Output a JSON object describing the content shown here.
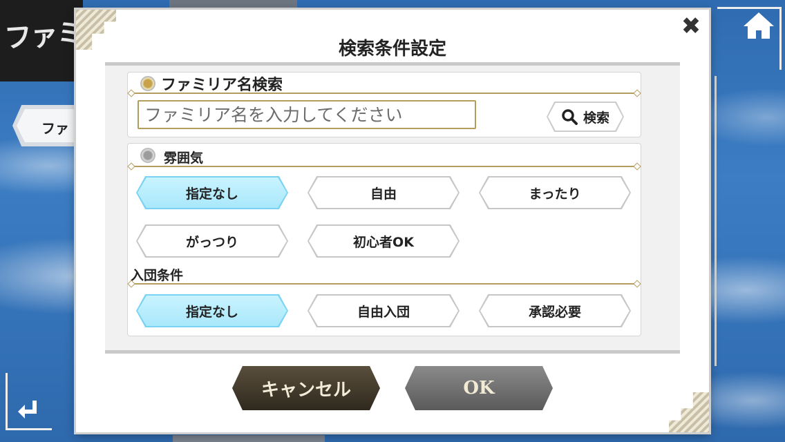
{
  "background": {
    "title_fragment": "ファミリ",
    "tab_fragment": "ファ",
    "home_icon": "home-icon",
    "back_icon": "return-arrow-icon"
  },
  "dialog": {
    "title": "検索条件設定",
    "close_glyph": "✖",
    "name_search": {
      "label": "ファミリア名検索",
      "placeholder": "ファミリア名を入力してください",
      "value": "",
      "search_button": "検索",
      "selected": true
    },
    "atmosphere": {
      "label": "雰囲気",
      "selected": false,
      "options": [
        {
          "label": "指定なし",
          "selected": true
        },
        {
          "label": "自由",
          "selected": false
        },
        {
          "label": "まったり",
          "selected": false
        },
        {
          "label": "がっつり",
          "selected": false
        },
        {
          "label": "初心者OK",
          "selected": false
        }
      ]
    },
    "join_condition": {
      "label": "入団条件",
      "options": [
        {
          "label": "指定なし",
          "selected": true
        },
        {
          "label": "自由入団",
          "selected": false
        },
        {
          "label": "承認必要",
          "selected": false
        }
      ]
    },
    "cancel_button": "キャンセル",
    "ok_button": "OK"
  },
  "colors": {
    "accent_gold": "#b49c5e",
    "selected_blue": "#7ad3f2",
    "cancel_brown": "#3d3527",
    "ok_gray": "#727272"
  }
}
